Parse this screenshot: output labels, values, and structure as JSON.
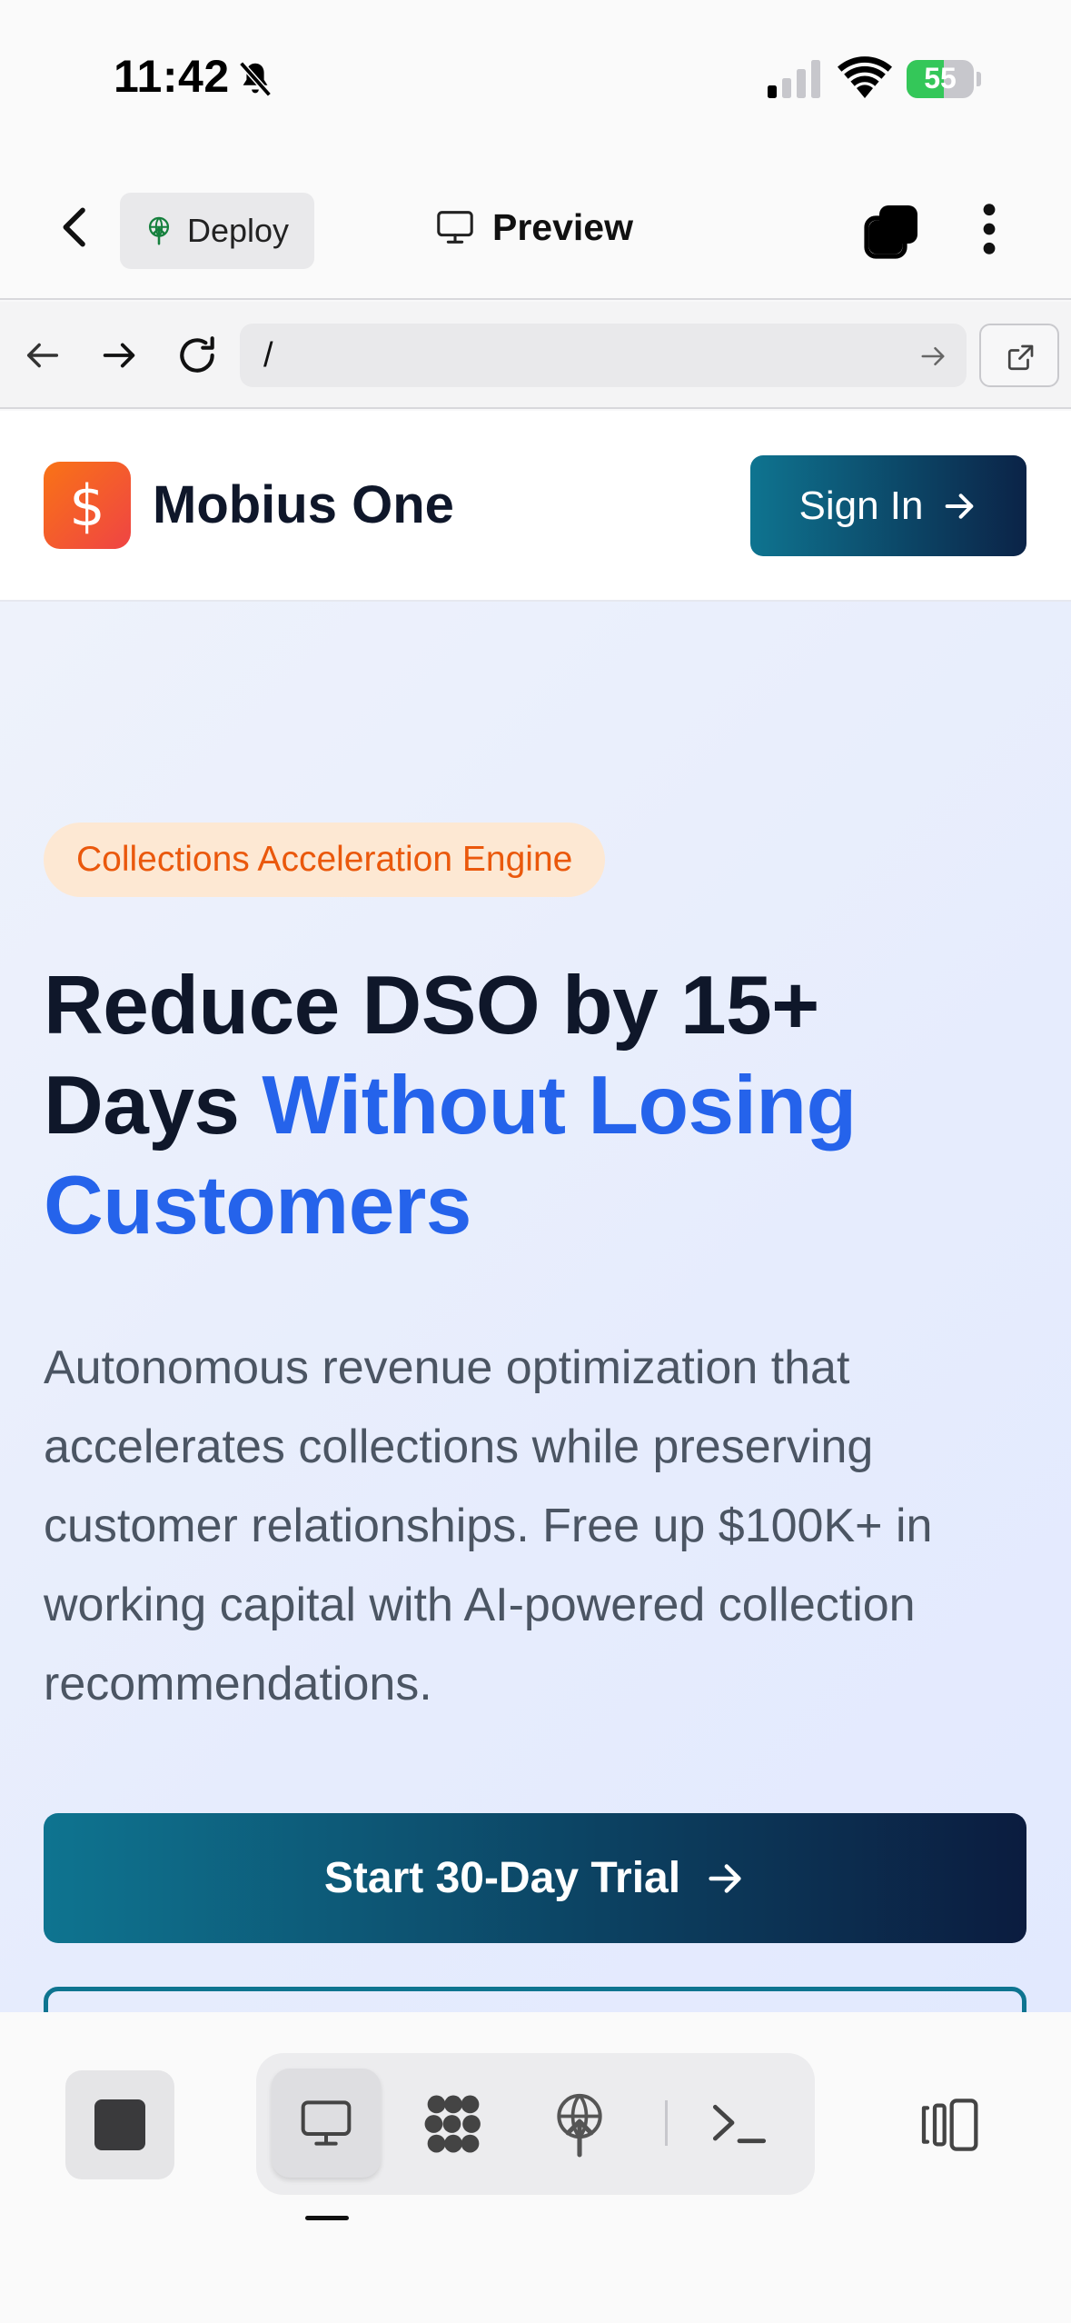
{
  "status_bar": {
    "time": "11:42",
    "battery_percent": "55",
    "battery_level": 0.55,
    "icons": [
      "bell-slash-icon",
      "cellular-signal-icon",
      "wifi-icon",
      "battery-charging-icon"
    ]
  },
  "app_bar": {
    "deploy_label": "Deploy",
    "preview_label": "Preview",
    "icons": [
      "chevron-left-icon",
      "deploy-icon",
      "monitor-icon",
      "tabs-icon",
      "more-vertical-icon"
    ]
  },
  "url_bar": {
    "path": "/",
    "icons": [
      "arrow-left-icon",
      "arrow-right-icon",
      "reload-icon",
      "go-arrow-icon",
      "open-external-icon"
    ]
  },
  "site": {
    "logo_symbol": "$",
    "brand": "Mobius One",
    "signin_label": "Sign In",
    "hero": {
      "badge": "Collections Acceleration Engine",
      "headline_line1": "Reduce DSO by 15+",
      "headline_line2_plain": "Days ",
      "headline_line2_accent": "Without Losing",
      "headline_line3_accent": "Customers",
      "subtitle": "Autonomous revenue optimization that accelerates collections while preserving customer relationships. Free up $100K+ in working capital with AI-powered collection recommendations.",
      "cta_label": "Start 30-Day Trial"
    },
    "colors": {
      "accent_blue": "#2563eb",
      "badge_orange": "#ea580c",
      "cta_gradient_start": "#0e7490",
      "cta_gradient_end": "#0b1c3f",
      "logo_gradient_start": "#f97316",
      "logo_gradient_end": "#ef4444"
    }
  },
  "bottom_toolbar": {
    "selected_tab": "preview",
    "icons": [
      "stop-icon",
      "monitor-icon",
      "grid-blob-icon",
      "deploy-icon",
      "terminal-icon",
      "side-panel-icon"
    ]
  }
}
